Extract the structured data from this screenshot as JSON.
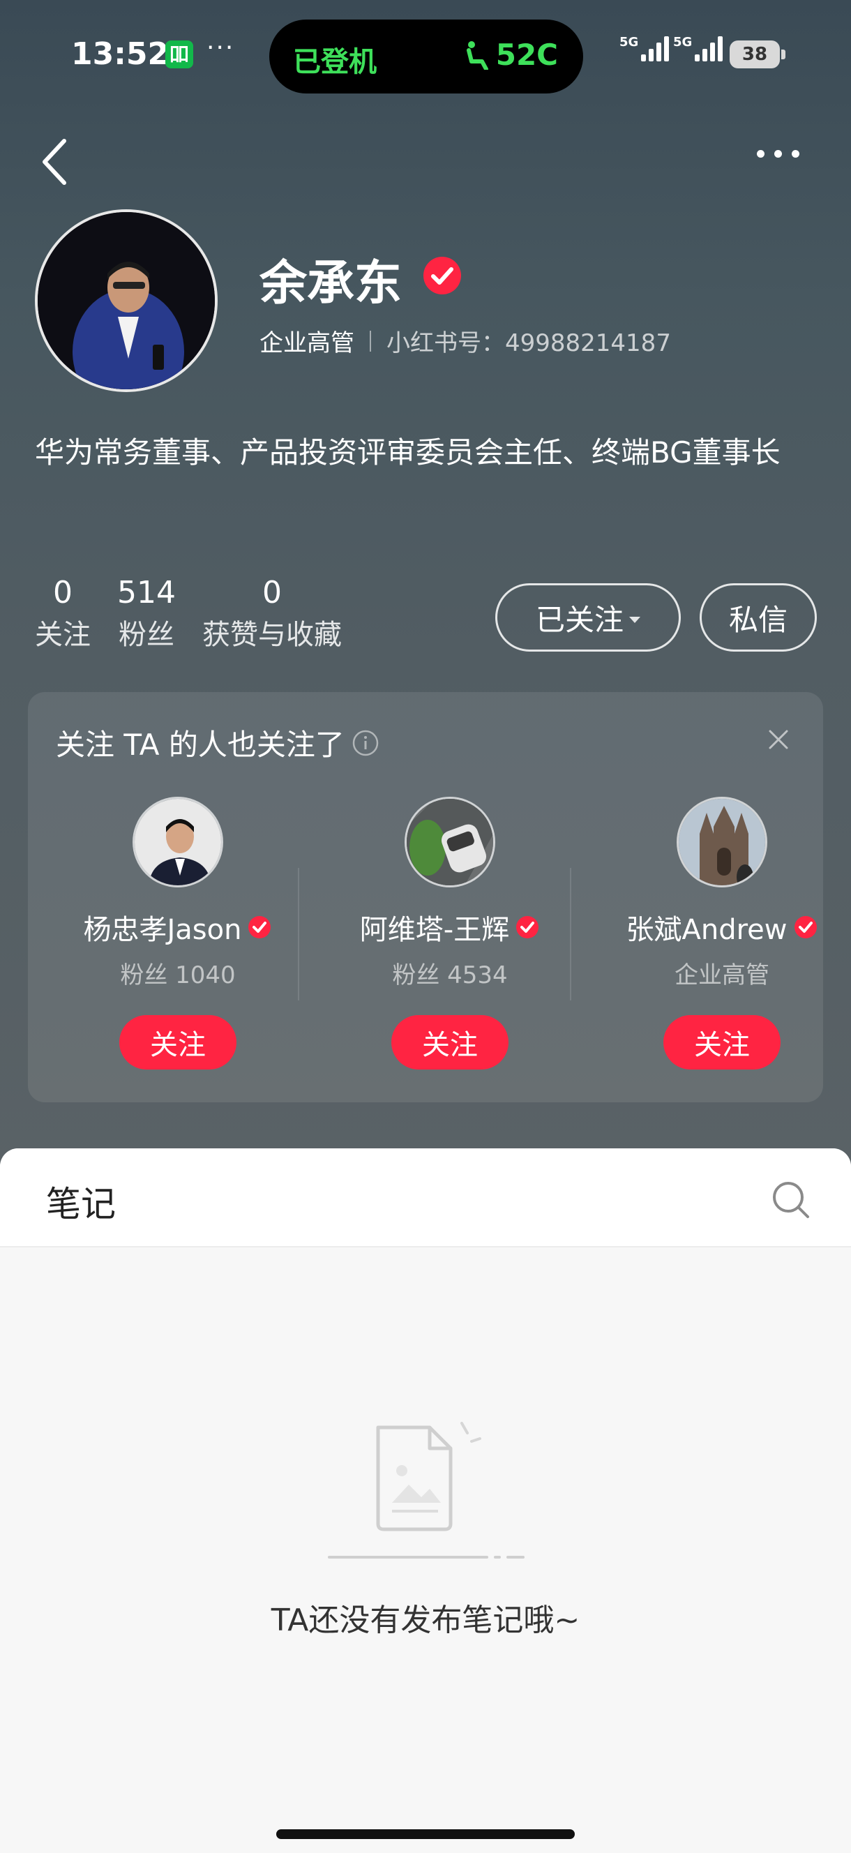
{
  "status_bar": {
    "time": "13:52",
    "app_badge": "吅",
    "dots": "···",
    "island_left": "已登机",
    "island_right": "52C",
    "network1": "5G",
    "network2": "5G",
    "battery": "38"
  },
  "profile": {
    "name": "余承东",
    "tag": "企业高管",
    "id_label": "小红书号：49988214187",
    "bio": "华为常务董事、产品投资评审委员会主任、终端BG董事长"
  },
  "stats": [
    {
      "num": "0",
      "label": "关注"
    },
    {
      "num": "514",
      "label": "粉丝"
    },
    {
      "num": "0",
      "label": "获赞与收藏"
    }
  ],
  "actions": {
    "following_label": "已关注",
    "message_label": "私信"
  },
  "recommend": {
    "title": "关注 TA 的人也关注了",
    "users": [
      {
        "name": "杨忠孝Jason",
        "sub": "粉丝 1040",
        "follow_label": "关注"
      },
      {
        "name": "阿维塔-王辉",
        "sub": "粉丝 4534",
        "follow_label": "关注"
      },
      {
        "name": "张斌Andrew",
        "sub": "企业高管",
        "follow_label": "关注"
      }
    ]
  },
  "notes": {
    "tab_label": "笔记",
    "empty_text": "TA还没有发布笔记哦~"
  },
  "colors": {
    "accent_red": "#ff2442",
    "island_green": "#3ee05a",
    "header_bg": "#47575f"
  },
  "icons": [
    "back-arrow-icon",
    "more-dots-icon",
    "verified-icon",
    "info-icon",
    "close-icon",
    "search-icon",
    "seat-icon",
    "empty-note-icon"
  ]
}
